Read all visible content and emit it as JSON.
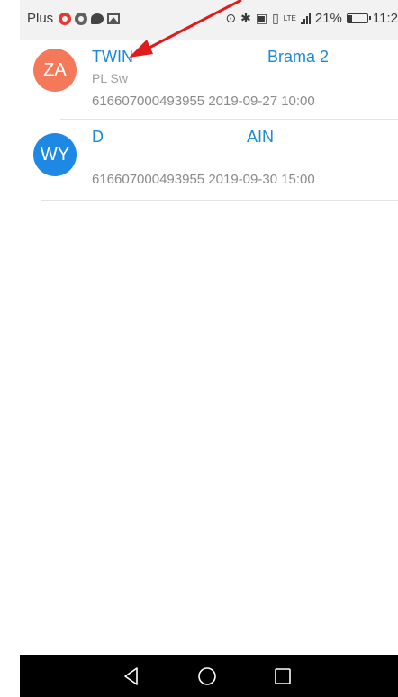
{
  "status_bar": {
    "carrier": "Plus",
    "lte_label": "LTE",
    "battery_percent": "21%",
    "battery_level": 0.21,
    "time": "11:2"
  },
  "conversations": [
    {
      "initials": "ZA",
      "avatar_color": "#f4795a",
      "title_visible": "TWIN",
      "title_suffix": "Brama 2",
      "subtitle": "PL Sw",
      "number": "616607000493955",
      "datetime": "2019-09-27 10:00"
    },
    {
      "initials": "WY",
      "avatar_color": "#1e88e5",
      "title_visible": "D",
      "title_suffix": "AIN",
      "subtitle": "",
      "number": "616607000493955",
      "datetime": "2019-09-30 15:00"
    }
  ],
  "annotation": {
    "color": "#e01b1b"
  },
  "nav": {
    "back_icon": "back-triangle-icon",
    "home_icon": "home-circle-icon",
    "recents_icon": "recents-square-icon"
  }
}
